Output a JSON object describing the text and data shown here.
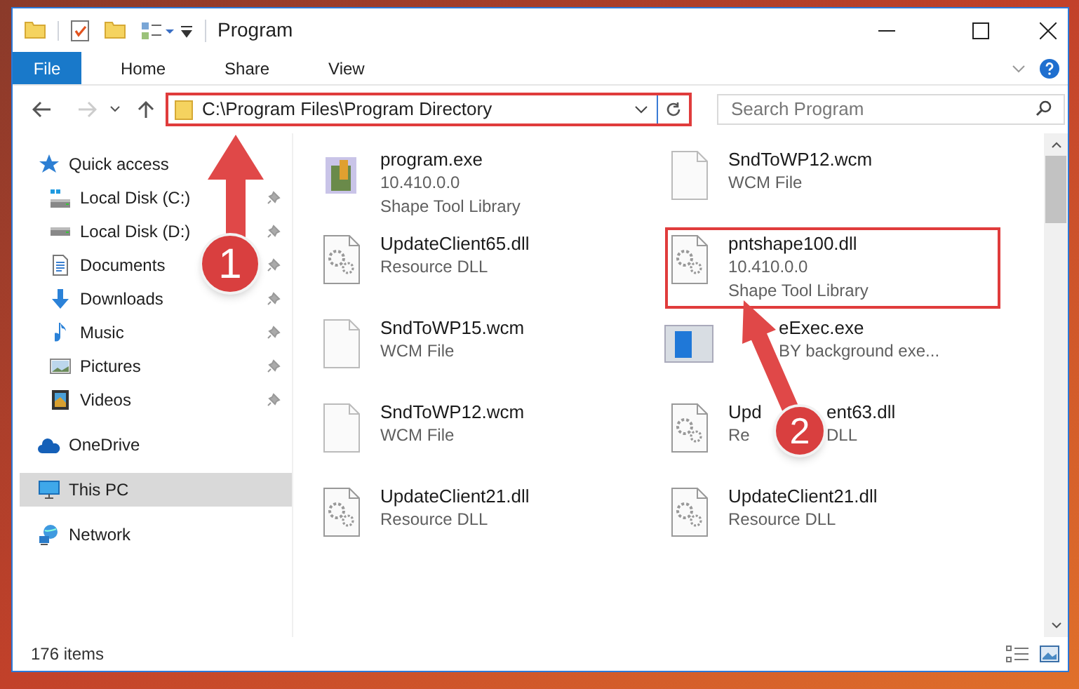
{
  "window": {
    "title": "Program"
  },
  "tabs": [
    {
      "label": "File",
      "selected": true
    },
    {
      "label": "Home",
      "selected": false
    },
    {
      "label": "Share",
      "selected": false
    },
    {
      "label": "View",
      "selected": false
    }
  ],
  "address": {
    "path": "C:\\Program Files\\Program Directory"
  },
  "search": {
    "placeholder": "Search Program"
  },
  "sidebar": {
    "items": [
      {
        "kind": "section",
        "label": "Quick access",
        "selected": false
      },
      {
        "kind": "item",
        "label": "Local Disk (C:)",
        "pinned": true,
        "selected": false
      },
      {
        "kind": "item",
        "label": "Local Disk (D:)",
        "pinned": true,
        "selected": false
      },
      {
        "kind": "item",
        "label": "Documents",
        "pinned": true,
        "selected": false
      },
      {
        "kind": "item",
        "label": "Downloads",
        "pinned": true,
        "selected": false
      },
      {
        "kind": "item",
        "label": "Music",
        "pinned": true,
        "selected": false
      },
      {
        "kind": "item",
        "label": "Pictures",
        "pinned": true,
        "selected": false
      },
      {
        "kind": "item",
        "label": "Videos",
        "pinned": true,
        "selected": false
      },
      {
        "kind": "section",
        "label": "OneDrive",
        "selected": false
      },
      {
        "kind": "section",
        "label": "This PC",
        "selected": true
      },
      {
        "kind": "section",
        "label": "Network",
        "selected": false
      }
    ]
  },
  "files": [
    {
      "kind": "exe",
      "name": "program.exe",
      "details": [
        "10.410.0.0",
        "Shape Tool Library"
      ]
    },
    {
      "kind": "blank",
      "name": "SndToWP12.wcm",
      "details": [
        "WCM File"
      ]
    },
    {
      "kind": "dll",
      "name": "UpdateClient65.dll",
      "details": [
        "Resource DLL"
      ]
    },
    {
      "kind": "dll",
      "name": "pntshape100.dll",
      "details": [
        "10.410.0.0",
        "Shape Tool Library"
      ]
    },
    {
      "kind": "blank",
      "name": "SndToWP15.wcm",
      "details": [
        "WCM File"
      ]
    },
    {
      "kind": "app",
      "name": "eExec.exe",
      "details": [
        "BY background exe..."
      ]
    },
    {
      "kind": "blank",
      "name": "SndToWP12.wcm",
      "details": [
        "WCM File"
      ]
    },
    {
      "kind": "dll",
      "name": [
        "Upd",
        "ent63.dll"
      ],
      "details": [
        [
          "Re",
          "DLL"
        ]
      ]
    },
    {
      "kind": "dll",
      "name": "UpdateClient21.dll",
      "details": [
        "Resource DLL"
      ]
    },
    {
      "kind": "dll",
      "name": "UpdateClient21.dll",
      "details": [
        "Resource DLL"
      ]
    }
  ],
  "status_bar": {
    "count": "176 items"
  },
  "callouts": [
    {
      "label": "1"
    },
    {
      "label": "2"
    }
  ]
}
